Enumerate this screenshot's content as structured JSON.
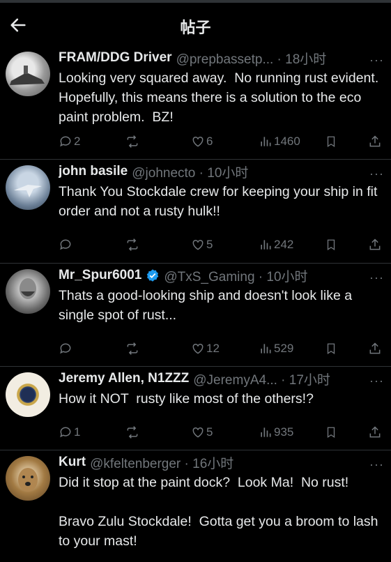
{
  "header": {
    "title": "帖子",
    "back_icon": "arrow-left-icon"
  },
  "posts": [
    {
      "name": "FRAM/DDG Driver",
      "handle": "@prepbassetp... · 18小时",
      "verified": false,
      "text": "Looking very squared away.  No running rust evident.  Hopefully, this means there is a solution to the eco paint problem.  BZ!",
      "replies": "2",
      "reposts": "",
      "likes": "6",
      "views": "1460"
    },
    {
      "name": "john basile",
      "handle": "@johnecto · 10小时",
      "verified": false,
      "text": "Thank You Stockdale crew for keeping your ship in fit order and not a rusty hulk!!",
      "replies": "",
      "reposts": "",
      "likes": "5",
      "views": "242"
    },
    {
      "name": "Mr_Spur6001",
      "handle": "@TxS_Gaming · 10小时",
      "verified": true,
      "text": "Thats a good-looking ship and doesn't look like a single spot of rust...",
      "replies": "",
      "reposts": "",
      "likes": "12",
      "views": "529"
    },
    {
      "name": "Jeremy Allen, N1ZZZ",
      "handle": "@JeremyA4... · 17小时",
      "verified": false,
      "text": "How it NOT  rusty like most of the others!?",
      "replies": "1",
      "reposts": "",
      "likes": "5",
      "views": "935"
    },
    {
      "name": "Kurt",
      "handle": "@kfeltenberger · 16小时",
      "verified": false,
      "text": "Did it stop at the paint dock?  Look Ma!  No rust!\n\nBravo Zulu Stockdale!  Gotta get you a broom to lash to your mast!",
      "replies": "",
      "reposts": "",
      "likes": "",
      "views": ""
    }
  ],
  "more_label": "···",
  "colors": {
    "background": "#000000",
    "text": "#e7e9ea",
    "muted": "#71767b",
    "divider": "#2f3336",
    "verified": "#1d9bf0"
  }
}
